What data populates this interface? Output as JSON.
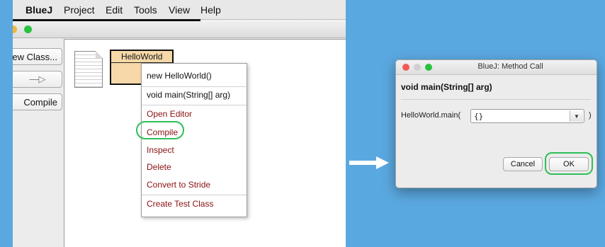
{
  "menubar": {
    "apple_glyph": ":",
    "items": [
      "BlueJ",
      "Project",
      "Edit",
      "Tools",
      "View",
      "Help"
    ]
  },
  "toolbar": {
    "new_class_label": "ew Class...",
    "arrow_glyph": "—▷",
    "compile_label": "Compile"
  },
  "class_box": {
    "name": "HelloWorld"
  },
  "context_menu": {
    "items": [
      "new HelloWorld()",
      "void main(String[] arg)",
      "Open Editor",
      "Compile",
      "Inspect",
      "Delete",
      "Convert to Stride",
      "Create Test Class"
    ]
  },
  "dialog": {
    "title": "BlueJ:  Method Call",
    "method_signature": "void main(String[] arg)",
    "call_prefix": "HelloWorld.main(",
    "arg_value": "{}",
    "call_suffix": ")",
    "cancel_label": "Cancel",
    "ok_label": "OK"
  },
  "colors": {
    "background": "#5aa8e0",
    "class_fill": "#f6d8a9",
    "highlight_ring": "#2fbf5a",
    "menu_red": "#8a1010"
  }
}
